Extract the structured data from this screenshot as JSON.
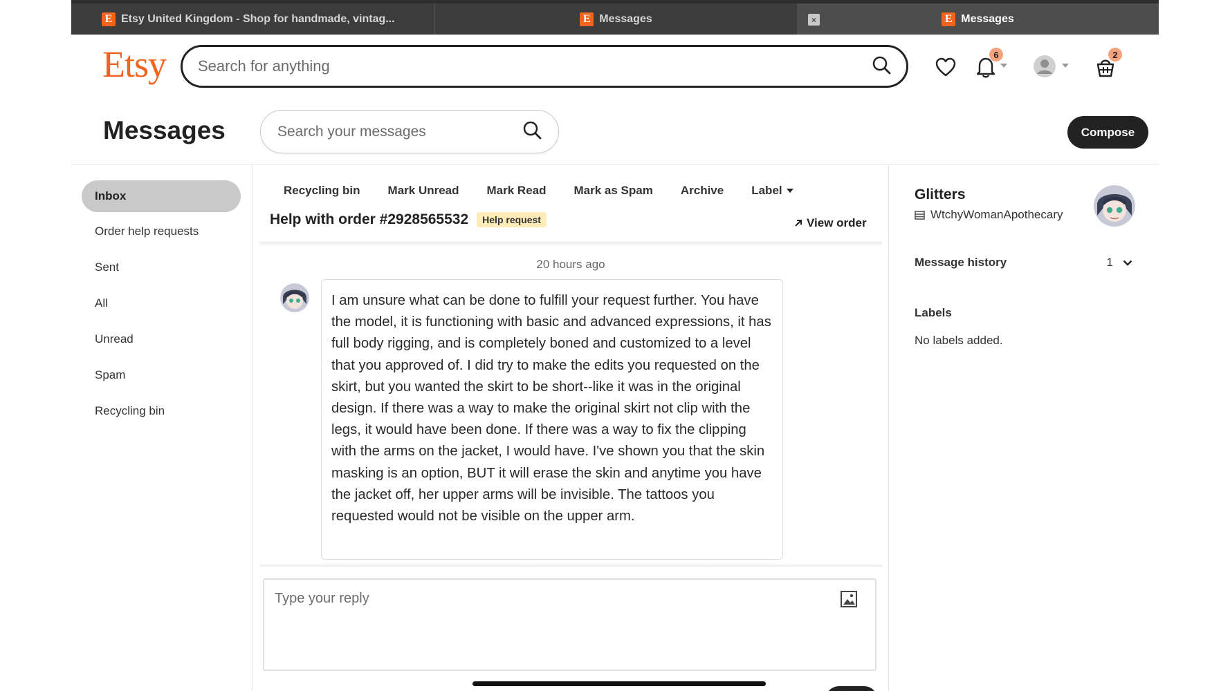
{
  "browser": {
    "tabs": [
      {
        "label": "Etsy United Kingdom - Shop for handmade, vintag...",
        "favicon": "E"
      },
      {
        "label": "Messages",
        "favicon": "E"
      },
      {
        "label": "Messages",
        "favicon": "E"
      }
    ],
    "close_glyph": "×"
  },
  "header": {
    "logo": "Etsy",
    "search_placeholder": "Search for anything",
    "notifications_count": "6",
    "cart_count": "2",
    "brand_color": "#f1641e"
  },
  "messages_page": {
    "title": "Messages",
    "search_placeholder": "Search your messages",
    "compose_label": "Compose"
  },
  "sidebar": {
    "items": [
      {
        "label": "Inbox",
        "active": true
      },
      {
        "label": "Order help requests"
      },
      {
        "label": "Sent"
      },
      {
        "label": "All"
      },
      {
        "label": "Unread"
      },
      {
        "label": "Spam"
      },
      {
        "label": "Recycling bin"
      }
    ]
  },
  "toolbar": {
    "recycle": "Recycling bin",
    "mark_unread": "Mark Unread",
    "mark_read": "Mark Read",
    "mark_spam": "Mark as Spam",
    "archive": "Archive",
    "label": "Label"
  },
  "thread": {
    "title": "Help with order #2928565532",
    "badge": "Help request",
    "view_order": "View order",
    "timestamp": "20 hours ago",
    "message": "I am unsure what can be done to fulfill your request further. You have the model, it is functioning with basic and advanced expressions, it has full body rigging, and is completely boned and customized to a level that you approved of. I did try to make the edits you requested on the skirt, but you wanted the skirt to be short--like it was in the original design. If there was a way to make the original skirt not clip with the legs, it would have been done. If there was a way to fix the clipping with the arms on the jacket, I would have. I've shown you that the skin masking is an option, BUT it will erase the skin and anytime you have the jacket off, her upper arms will be invisible. The tattoos you requested would not be visible on the upper arm.",
    "reply_placeholder": "Type your reply"
  },
  "details": {
    "name": "Glitters",
    "shop": "WtchyWomanApothecary",
    "history_label": "Message history",
    "history_count": "1",
    "labels_title": "Labels",
    "labels_empty": "No labels added."
  }
}
